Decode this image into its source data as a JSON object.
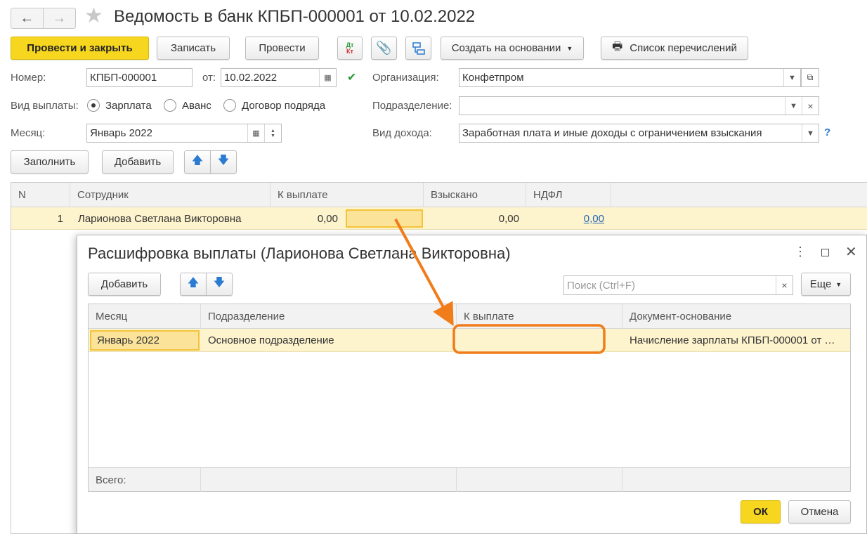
{
  "title": "Ведомость в банк КПБП-000001 от 10.02.2022",
  "toolbar": {
    "post_close": "Провести и закрыть",
    "save": "Записать",
    "post": "Провести",
    "dtkt_top": "Дт",
    "dtkt_bottom": "Кт",
    "create_based": "Создать на основании",
    "payments_list": "Список перечислений"
  },
  "form": {
    "number_label": "Номер:",
    "number_value": "КПБП-000001",
    "from_label": "от:",
    "date_value": "10.02.2022",
    "org_label": "Организация:",
    "org_value": "Конфетпром",
    "payment_type_label": "Вид выплаты:",
    "payment_types": [
      "Зарплата",
      "Аванс",
      "Договор подряда"
    ],
    "selected_payment_type": "Зарплата",
    "division_label": "Подразделение:",
    "division_value": "",
    "month_label": "Месяц:",
    "month_value": "Январь 2022",
    "income_label": "Вид дохода:",
    "income_value": "Заработная плата и иные доходы с ограничением взыскания",
    "help": "?"
  },
  "actions": {
    "fill": "Заполнить",
    "add": "Добавить"
  },
  "table": {
    "columns": [
      "N",
      "Сотрудник",
      "К выплате",
      "Взыскано",
      "НДФЛ"
    ],
    "rows": [
      {
        "n": "1",
        "employee": "Ларионова Светлана Викторовна",
        "to_pay": "0,00",
        "withheld": "0,00",
        "ndfl": "0,00"
      }
    ]
  },
  "dialog": {
    "title": "Расшифровка выплаты (Ларионова Светлана Викторовна)",
    "add": "Добавить",
    "search_placeholder": "Поиск (Ctrl+F)",
    "more": "Еще",
    "columns": [
      "Месяц",
      "Подразделение",
      "К выплате",
      "Документ-основание"
    ],
    "rows": [
      {
        "month": "Январь 2022",
        "division": "Основное подразделение",
        "to_pay": "",
        "document": "Начисление зарплаты КПБП-000001 от …"
      }
    ],
    "total_label": "Всего:",
    "ok": "ОК",
    "cancel": "Отмена"
  },
  "colors": {
    "accent": "#f6d61e",
    "selected_row": "#fdf3cd",
    "annotation": "#f07c1a",
    "link": "#2266b8"
  }
}
